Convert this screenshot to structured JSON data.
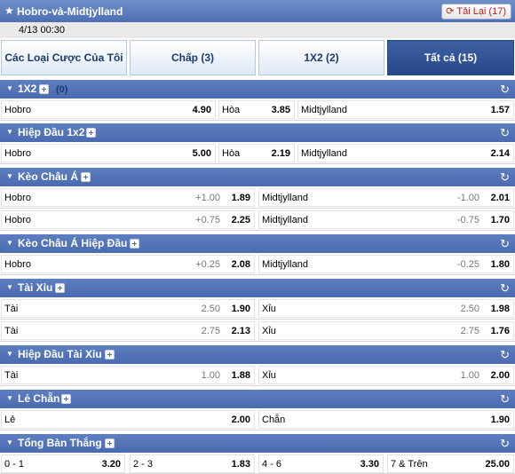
{
  "header": {
    "title": "Hobro-và-Midtjylland",
    "refresh_label": "Tải Lại (17)",
    "date": "4/13 00:30"
  },
  "tabs": [
    "Các Loại Cược Của Tôi",
    "Chấp (3)",
    "1X2 (2)",
    "Tất cả (15)"
  ],
  "sections": {
    "s1": {
      "name": "1X2",
      "count": "(0)",
      "r1": {
        "home": "Hobro",
        "home_odd": "4.90",
        "draw": "Hòa",
        "draw_odd": "3.85",
        "away": "Midtjylland",
        "away_odd": "1.57"
      }
    },
    "s2": {
      "name": "Hiệp Đầu 1x2",
      "r1": {
        "home": "Hobro",
        "home_odd": "5.00",
        "draw": "Hòa",
        "draw_odd": "2.19",
        "away": "Midtjylland",
        "away_odd": "2.14"
      }
    },
    "s3": {
      "name": "Kèo Châu Á",
      "r1": {
        "home": "Hobro",
        "home_line": "+1.00",
        "home_odd": "1.89",
        "away": "Midtjylland",
        "away_line": "-1.00",
        "away_odd": "2.01"
      },
      "r2": {
        "home": "Hobro",
        "home_line": "+0.75",
        "home_odd": "2.25",
        "away": "Midtjylland",
        "away_line": "-0.75",
        "away_odd": "1.70"
      }
    },
    "s4": {
      "name": "Kèo Châu Á Hiệp Đầu",
      "r1": {
        "home": "Hobro",
        "home_line": "+0.25",
        "home_odd": "2.08",
        "away": "Midtjylland",
        "away_line": "-0.25",
        "away_odd": "1.80"
      }
    },
    "s5": {
      "name": "Tài Xỉu",
      "r1": {
        "home": "Tài",
        "home_line": "2.50",
        "home_odd": "1.90",
        "away": "Xỉu",
        "away_line": "2.50",
        "away_odd": "1.98"
      },
      "r2": {
        "home": "Tài",
        "home_line": "2.75",
        "home_odd": "2.13",
        "away": "Xỉu",
        "away_line": "2.75",
        "away_odd": "1.76"
      }
    },
    "s6": {
      "name": "Hiệp Đầu Tài Xỉu",
      "r1": {
        "home": "Tài",
        "home_line": "1.00",
        "home_odd": "1.88",
        "away": "Xỉu",
        "away_line": "1.00",
        "away_odd": "2.00"
      }
    },
    "s7": {
      "name": "Lẻ Chẵn",
      "r1": {
        "home": "Lẻ",
        "home_odd": "2.00",
        "away": "Chẵn",
        "away_odd": "1.90"
      }
    },
    "s8": {
      "name": "Tổng Bàn Thắng",
      "r1": {
        "c1": "0 - 1",
        "c1_odd": "3.20",
        "c2": "2 - 3",
        "c2_odd": "1.83",
        "c3": "4 - 6",
        "c3_odd": "3.30",
        "c4": "7 & Trên",
        "c4_odd": "25.00"
      }
    }
  },
  "colors": {
    "header_blue": "#4a6bb0",
    "tab_active": "#26488b",
    "refresh_red": "#c02020"
  },
  "icons": {
    "star": "star-icon",
    "refresh": "refresh-icon",
    "expand": "plus-box-icon",
    "collapse": "triangle-down-icon"
  }
}
